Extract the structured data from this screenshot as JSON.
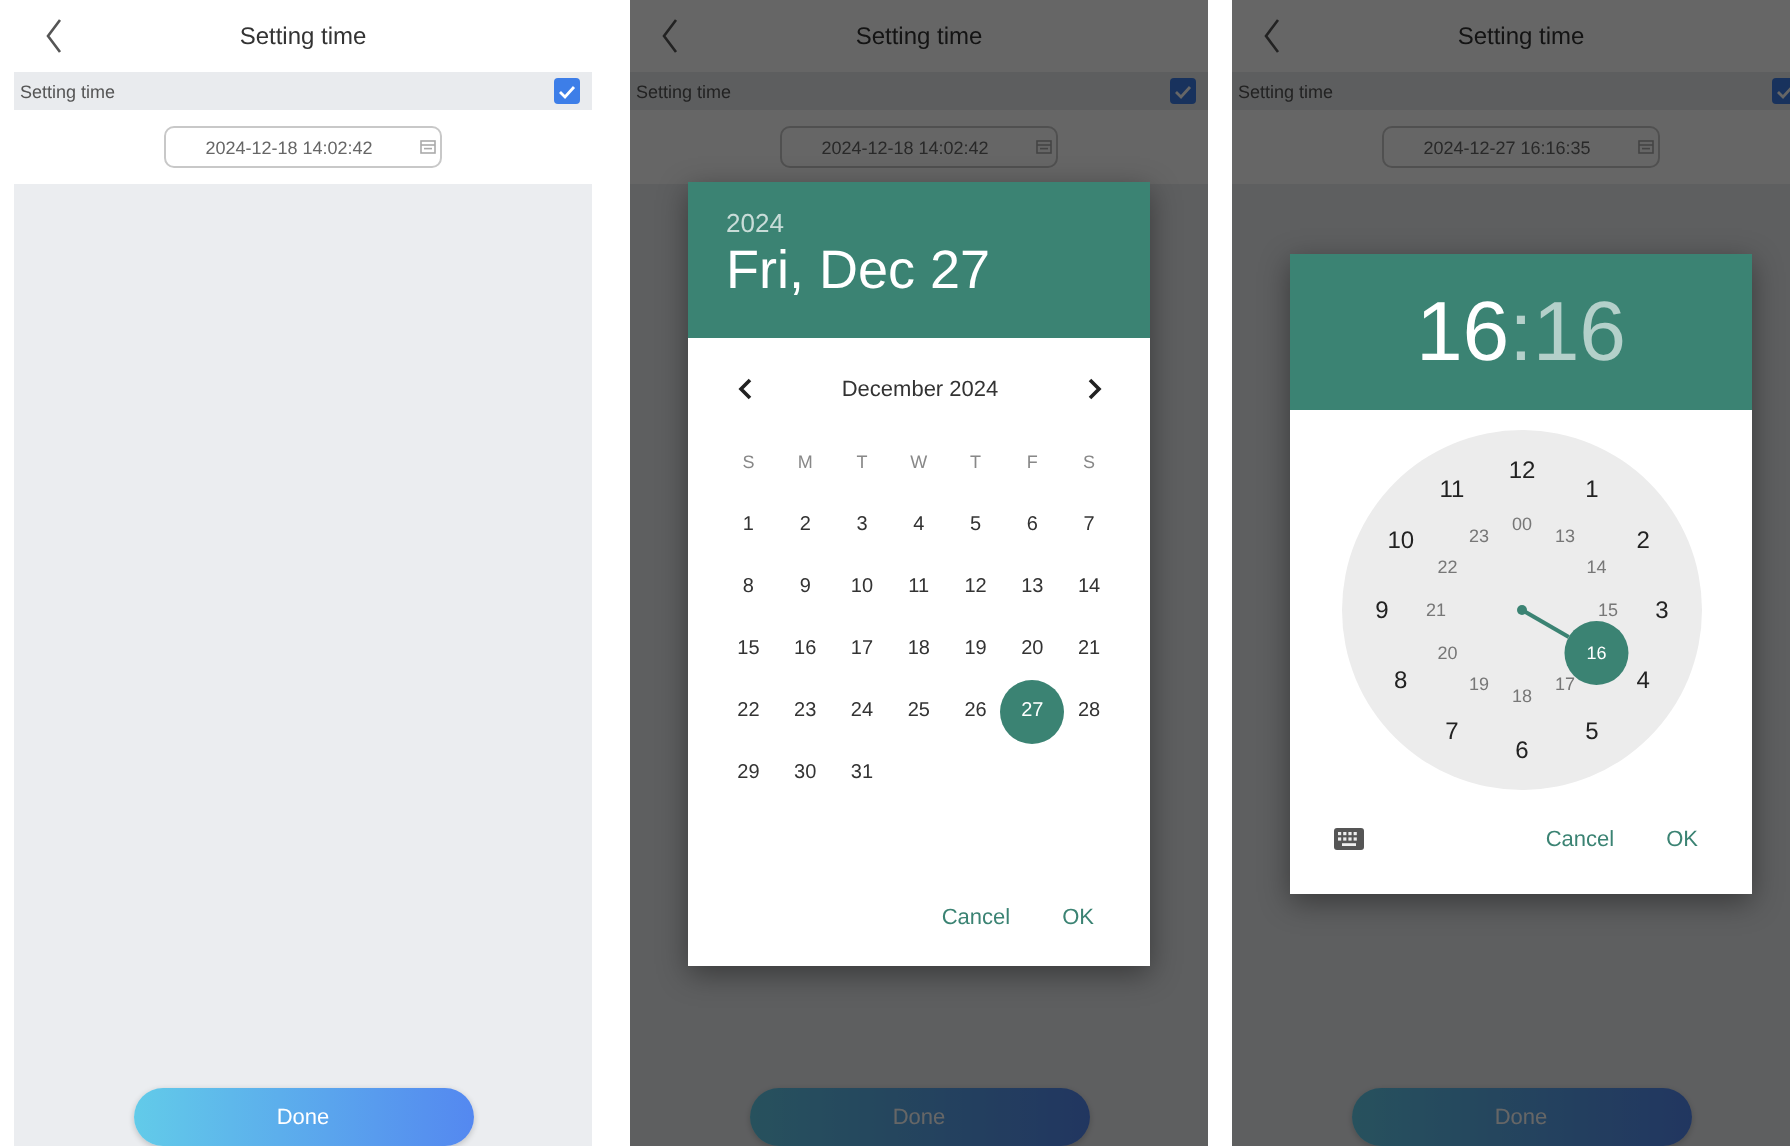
{
  "screens": [
    {
      "header": {
        "title": "Setting time"
      },
      "setting": {
        "label": "Setting time",
        "checked": true
      },
      "date_field": {
        "value": "2024-12-18 14:02:42"
      },
      "done_button": {
        "label": "Done"
      }
    },
    {
      "header": {
        "title": "Setting time"
      },
      "setting": {
        "label": "Setting time",
        "checked": true
      },
      "date_field": {
        "value": "2024-12-18 14:02:42"
      },
      "done_button": {
        "label": "Done"
      },
      "dialog": {
        "kind": "date",
        "year": "2024",
        "date": "Fri, Dec 27",
        "month": "December 2024",
        "weekdays": [
          "S",
          "M",
          "T",
          "W",
          "T",
          "F",
          "S"
        ],
        "days": [
          {
            "text": "1",
            "selected": false
          },
          {
            "text": "2",
            "selected": false
          },
          {
            "text": "3",
            "selected": false
          },
          {
            "text": "4",
            "selected": false
          },
          {
            "text": "5",
            "selected": false
          },
          {
            "text": "6",
            "selected": false
          },
          {
            "text": "7",
            "selected": false
          },
          {
            "text": "8",
            "selected": false
          },
          {
            "text": "9",
            "selected": false
          },
          {
            "text": "10",
            "selected": false
          },
          {
            "text": "11",
            "selected": false
          },
          {
            "text": "12",
            "selected": false
          },
          {
            "text": "13",
            "selected": false
          },
          {
            "text": "14",
            "selected": false
          },
          {
            "text": "15",
            "selected": false
          },
          {
            "text": "16",
            "selected": false
          },
          {
            "text": "17",
            "selected": false
          },
          {
            "text": "18",
            "selected": false
          },
          {
            "text": "19",
            "selected": false
          },
          {
            "text": "20",
            "selected": false
          },
          {
            "text": "21",
            "selected": false
          },
          {
            "text": "22",
            "selected": false
          },
          {
            "text": "23",
            "selected": false
          },
          {
            "text": "24",
            "selected": false
          },
          {
            "text": "25",
            "selected": false
          },
          {
            "text": "26",
            "selected": false
          },
          {
            "text": "27",
            "selected": true
          },
          {
            "text": "28",
            "selected": false
          },
          {
            "text": "29",
            "selected": false
          },
          {
            "text": "30",
            "selected": false
          },
          {
            "text": "31",
            "selected": false
          }
        ],
        "buttons": [
          "Cancel",
          "OK"
        ]
      }
    },
    {
      "header": {
        "title": "Setting time"
      },
      "setting": {
        "label": "Setting time",
        "checked": true
      },
      "date_field": {
        "value": "2024-12-27 16:16:35"
      },
      "done_button": {
        "label": "Done"
      },
      "dialog": {
        "kind": "time",
        "hour": {
          "text": "16",
          "selected": true
        },
        "separator": ":",
        "minute": {
          "text": "16",
          "selected": false
        },
        "dial_outer": [
          {
            "text": "12",
            "selected": false
          },
          {
            "text": "1",
            "selected": false
          },
          {
            "text": "2",
            "selected": false
          },
          {
            "text": "3",
            "selected": false
          },
          {
            "text": "4",
            "selected": false
          },
          {
            "text": "5",
            "selected": false
          },
          {
            "text": "6",
            "selected": false
          },
          {
            "text": "7",
            "selected": false
          },
          {
            "text": "8",
            "selected": false
          },
          {
            "text": "9",
            "selected": false
          },
          {
            "text": "10",
            "selected": false
          },
          {
            "text": "11",
            "selected": false
          }
        ],
        "dial_inner": [
          {
            "text": "00",
            "selected": false
          },
          {
            "text": "13",
            "selected": false
          },
          {
            "text": "14",
            "selected": false
          },
          {
            "text": "15",
            "selected": false
          },
          {
            "text": "16",
            "selected": true
          },
          {
            "text": "17",
            "selected": false
          },
          {
            "text": "18",
            "selected": false
          },
          {
            "text": "19",
            "selected": false
          },
          {
            "text": "20",
            "selected": false
          },
          {
            "text": "21",
            "selected": false
          },
          {
            "text": "22",
            "selected": false
          },
          {
            "text": "23",
            "selected": false
          }
        ],
        "buttons": [
          "Cancel",
          "OK"
        ]
      }
    }
  ]
}
